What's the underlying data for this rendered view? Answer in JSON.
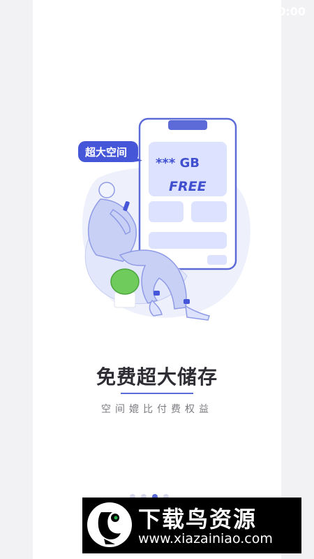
{
  "status_bar": {
    "time": "0:00"
  },
  "illustration": {
    "bubble_label": "超大空间",
    "card_size_text": "*** GB",
    "card_free_text": "FREE"
  },
  "onboarding": {
    "title": "免费超大储存",
    "subtitle": "空间媲比付费权益",
    "page_count": 4,
    "active_page": 2
  },
  "watermark": {
    "title": "下载鸟资源",
    "url": "www.xiazainiao.com"
  },
  "colors": {
    "accent": "#5c6bd8",
    "phone_fill": "#dde3ff",
    "blob": "#eef0fc",
    "text_dark": "#2d2d33",
    "text_gray": "#7c7c82"
  }
}
